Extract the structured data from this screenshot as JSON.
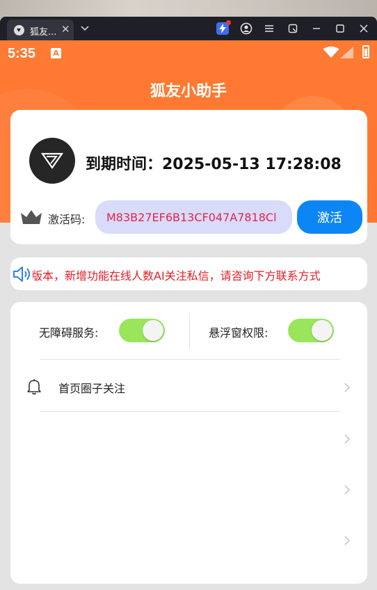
{
  "browser": {
    "tab_title": "狐友...",
    "tab_close_glyph": "✕"
  },
  "status_bar": {
    "time": "5:35",
    "notification_icon_letter": "A"
  },
  "app": {
    "title": "狐友小助手",
    "expire_text": "到期时间：2025-05-13 17:28:08",
    "activation": {
      "label": "激活码:",
      "code_value": "M83B27EF6B13CF047A7818Cl",
      "button_label": "激活"
    },
    "notice": "版本，新增功能在线人数AI关注私信，请咨询下方联系方式",
    "permissions": [
      {
        "label": "无障碍服务:",
        "enabled": true
      },
      {
        "label": "悬浮窗权限:",
        "enabled": true
      }
    ],
    "menu_items": [
      {
        "label": "首页圈子关注",
        "icon": "bell-icon"
      },
      {
        "label": ""
      },
      {
        "label": ""
      },
      {
        "label": ""
      }
    ]
  },
  "colors": {
    "accent_orange": "#ff7a33",
    "activate_blue": "#0d86f5",
    "toggle_green": "#99e55c",
    "notice_red": "#e51c23",
    "code_bg": "#d9dbfa"
  }
}
